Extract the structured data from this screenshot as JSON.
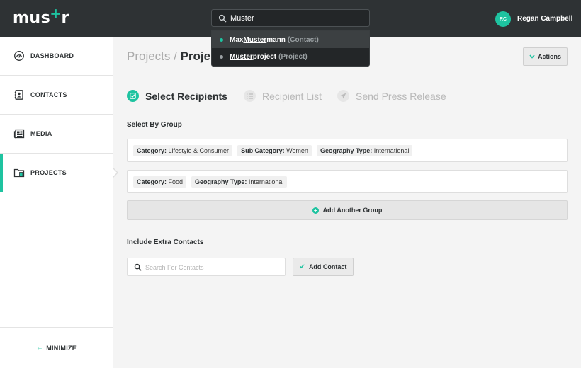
{
  "topbar": {
    "logo_left": "mus",
    "logo_plus": "+",
    "logo_right": "r",
    "search": {
      "value": "Muster"
    },
    "suggestions": [
      {
        "pre": "Max ",
        "match": "Muster",
        "post": "mann",
        "type": "(Contact)",
        "dot_color": "#1ec3a0"
      },
      {
        "pre": "",
        "match": "Muster",
        "post": "project",
        "type": "(Project)",
        "dot_color": "#9aa0a3"
      }
    ],
    "user": {
      "initials": "RC",
      "name": "Regan Campbell"
    }
  },
  "sidebar": {
    "items": [
      {
        "label": "DASHBOARD",
        "icon": "dashboard-icon"
      },
      {
        "label": "CONTACTS",
        "icon": "contacts-icon"
      },
      {
        "label": "MEDIA",
        "icon": "media-icon"
      },
      {
        "label": "PROJECTS",
        "icon": "projects-icon"
      }
    ],
    "minimize_arrow": "←",
    "minimize_label": "MINIMIZE"
  },
  "header": {
    "breadcrumb_parent": "Projects",
    "breadcrumb_sep": " / ",
    "breadcrumb_current": "Proje",
    "actions_chevron": "⌄",
    "actions_label": "Actions"
  },
  "steps": [
    {
      "label": "Select Recipients",
      "status": "active"
    },
    {
      "label": "Recipient List",
      "status": "pending"
    },
    {
      "label": "Send Press Release",
      "status": "pending"
    }
  ],
  "groups": {
    "title": "Select By Group",
    "rows": [
      [
        {
          "key": "Category:",
          "value": " Lifestyle & Consumer"
        },
        {
          "key": "Sub Category:",
          "value": " Women"
        },
        {
          "key": "Geography Type:",
          "value": " International"
        }
      ],
      [
        {
          "key": "Category:",
          "value": " Food"
        },
        {
          "key": "Geography Type:",
          "value": " International"
        }
      ]
    ],
    "add_label": "Add Another Group",
    "add_icon": "+"
  },
  "extra": {
    "title": "Include Extra Contacts",
    "search_placeholder": "Search For Contacts",
    "add_icon": "✔",
    "add_label": "Add Contact"
  },
  "colors": {
    "accent": "#1ec3a0",
    "topbar": "#2e3234"
  }
}
